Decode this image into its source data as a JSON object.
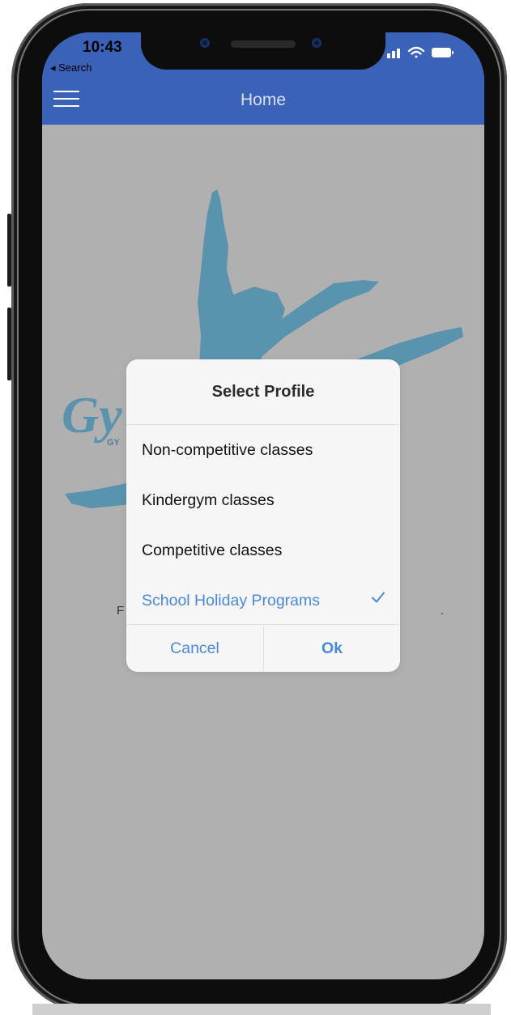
{
  "status_bar": {
    "time": "10:43",
    "back_label": "◂ Search"
  },
  "app_bar": {
    "title": "Home",
    "menu_icon": "hamburger-menu-icon"
  },
  "background": {
    "logo_text": "Gy",
    "logo_subtext": "GY",
    "partial_text_left": "F",
    "partial_text_right": "."
  },
  "dialog": {
    "title": "Select Profile",
    "options": [
      {
        "label": "Non-competitive classes",
        "selected": false
      },
      {
        "label": "Kindergym classes",
        "selected": false
      },
      {
        "label": "Competitive classes",
        "selected": false
      },
      {
        "label": "School Holiday Programs",
        "selected": true
      }
    ],
    "cancel_label": "Cancel",
    "ok_label": "Ok"
  },
  "colors": {
    "app_bar": "#3a62b8",
    "accent": "#4a88dd",
    "logo": "#5a93ad",
    "backdrop": "#b0b0b0"
  }
}
